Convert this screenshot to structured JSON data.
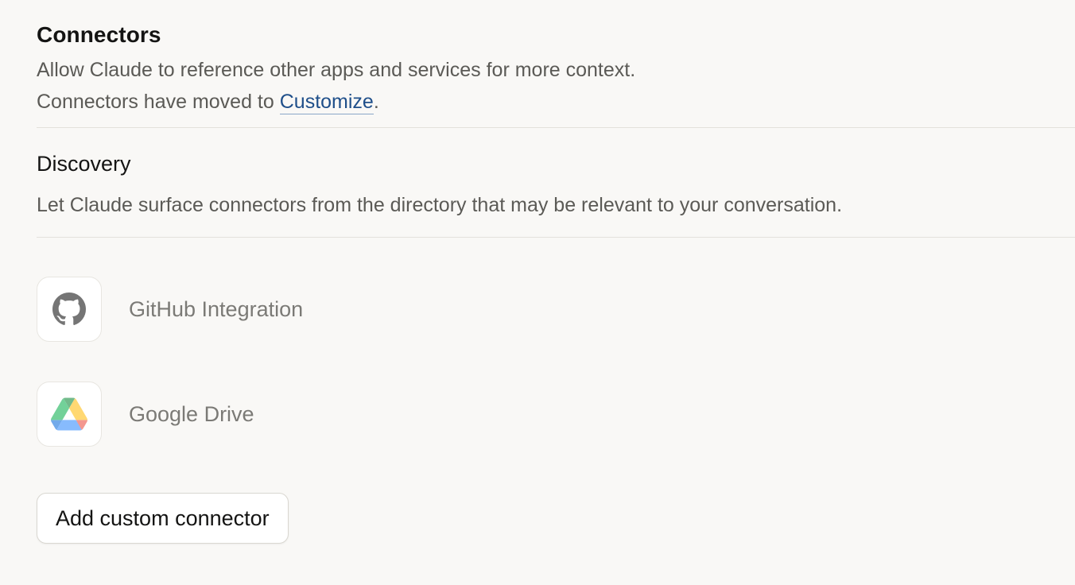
{
  "connectors": {
    "title": "Connectors",
    "description": "Allow Claude to reference other apps and services for more context.",
    "moved_prefix": "Connectors have moved to ",
    "moved_link": "Customize",
    "moved_suffix": "."
  },
  "discovery": {
    "title": "Discovery",
    "description": "Let Claude surface connectors from the directory that may be relevant to your conversation."
  },
  "connector_list": [
    {
      "label": "GitHub Integration",
      "icon": "github-icon"
    },
    {
      "label": "Google Drive",
      "icon": "google-drive-icon"
    }
  ],
  "actions": {
    "add_custom_connector": "Add custom connector"
  },
  "colors": {
    "background": "#f9f8f6",
    "link": "#1f4f8a",
    "muted_text": "#5b5a56",
    "connector_label": "#7b7a76"
  }
}
